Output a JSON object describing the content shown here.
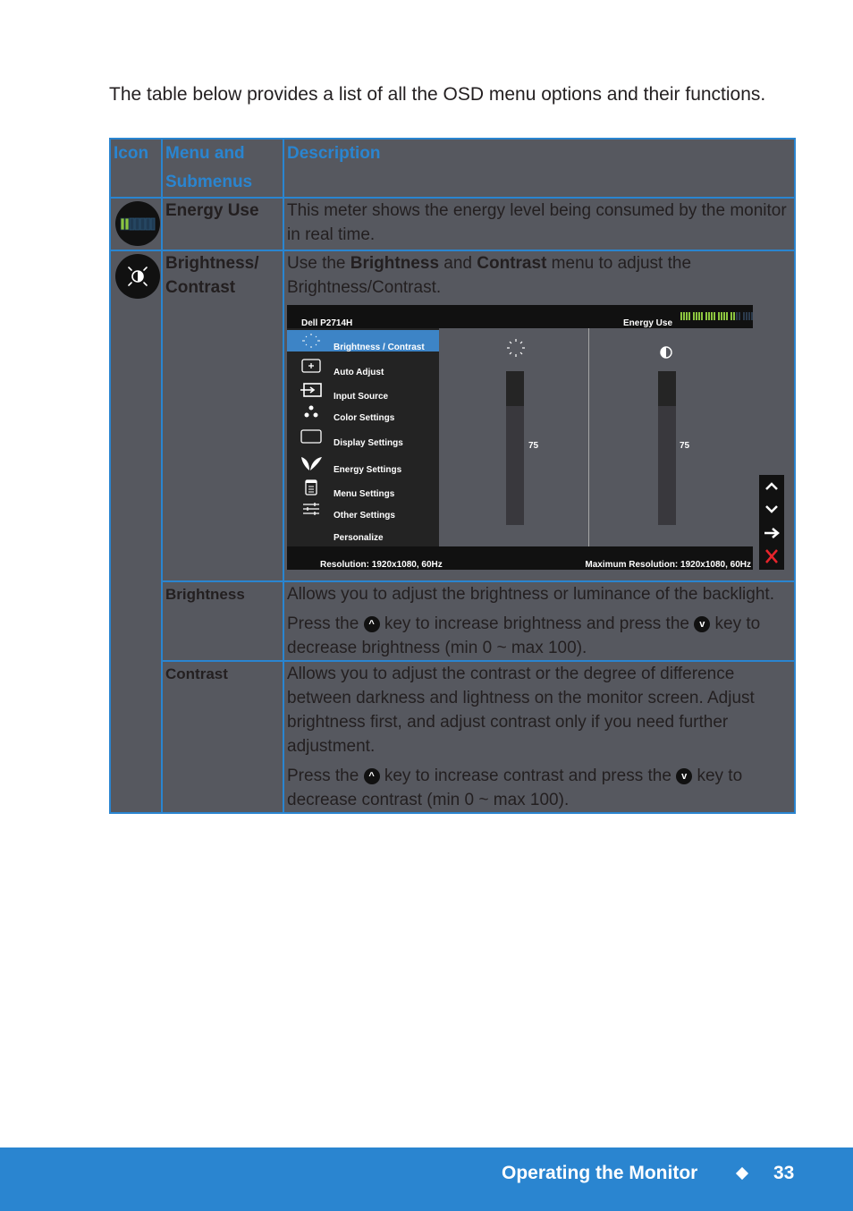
{
  "intro": "The table below provides a list of all the OSD menu options and their functions.",
  "table": {
    "headers": {
      "icon": "Icon",
      "menu_line1": "Menu and",
      "menu_line2": "Submenus",
      "description": "Description"
    },
    "rows": {
      "energy_use": {
        "icon": "energy-meter-icon",
        "menu": "Energy Use",
        "description": "This meter shows the energy level being consumed by the monitor in real time."
      },
      "brightness_contrast": {
        "icon": "brightness-contrast-icon",
        "menu_line1": "Brightness/",
        "menu_line2": "Contrast",
        "desc_prefix": "Use the ",
        "desc_bold1": "Brightness",
        "desc_mid": " and ",
        "desc_bold2": "Contrast",
        "desc_suffix": " menu to adjust the Brightness/Contrast."
      },
      "brightness": {
        "menu": "Brightness",
        "p1": "Allows you to adjust the brightness or luminance of the backlight.",
        "p2_a": "Press the ",
        "p2_b": " key to increase brightness and press the ",
        "p2_c": " key to decrease brightness (min 0 ~ max 100)."
      },
      "contrast": {
        "menu": "Contrast",
        "p1": "Allows you to adjust the contrast or the degree of difference between darkness and lightness on the monitor screen. Adjust brightness first, and adjust contrast only if you need further adjustment.",
        "p2_a": "Press the ",
        "p2_b": " key to increase contrast and press the ",
        "p2_c": " key to decrease contrast (min 0 ~ max 100)."
      }
    },
    "key_up_glyph": "^",
    "key_down_glyph": "v"
  },
  "osd": {
    "model": "Dell P2714H",
    "energy_label": "Energy Use",
    "energy_level_fraction": 0.75,
    "menu_items": [
      {
        "label": "Brightness / Contrast",
        "icon": "brightness-icon",
        "active": true
      },
      {
        "label": "Auto Adjust",
        "icon": "auto-adjust-icon",
        "active": false
      },
      {
        "label": "Input Source",
        "icon": "input-source-icon",
        "active": false
      },
      {
        "label": "Color Settings",
        "icon": "color-settings-icon",
        "active": false
      },
      {
        "label": "Display Settings",
        "icon": "display-settings-icon",
        "active": false
      },
      {
        "label": "Energy Settings",
        "icon": "energy-settings-icon",
        "active": false
      },
      {
        "label": "Menu Settings",
        "icon": "menu-settings-icon",
        "active": false
      },
      {
        "label": "Other Settings",
        "icon": "other-settings-icon",
        "active": false
      },
      {
        "label": "Personalize",
        "icon": "",
        "active": false
      }
    ],
    "brightness_value": "75",
    "contrast_value": "75",
    "brightness_level": 75,
    "contrast_level": 75,
    "resolution": "Resolution: 1920x1080, 60Hz",
    "max_resolution": "Maximum Resolution: 1920x1080, 60Hz",
    "side_keys": [
      "up-icon",
      "down-icon",
      "enter-arrow-icon",
      "exit-x-icon"
    ],
    "colors": {
      "active": "#3d84c6",
      "meter_on": "#8cc63f",
      "meter_off": "#2b3a4c",
      "exit": "#e8242b"
    }
  },
  "footer": {
    "section": "Operating the Monitor",
    "page": "33"
  }
}
